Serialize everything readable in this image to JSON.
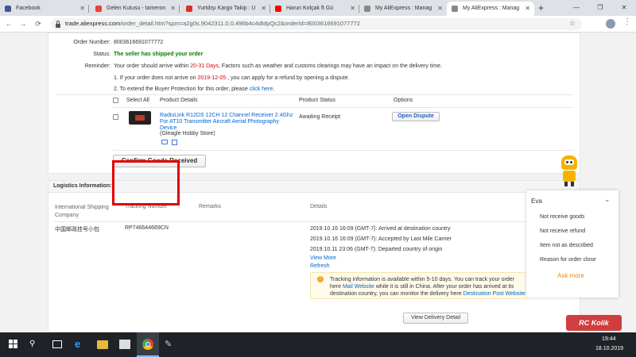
{
  "browser": {
    "tabs": [
      {
        "label": "Facebook",
        "color": "#3b5998"
      },
      {
        "label": "Gelen Kutusu - tameron",
        "color": "#ea4335"
      },
      {
        "label": "Yurtdışı Kargo Takip : U",
        "color": "#d93025"
      },
      {
        "label": "Harun Kolçak ft Gü",
        "color": "#ff0000"
      },
      {
        "label": "My AliExpress : Manag",
        "color": "#888888"
      },
      {
        "label": "My AliExpress : Manag",
        "color": "#888888"
      }
    ],
    "url_host": "trade.aliexpress.com",
    "url_path": "/order_detail.htm?spm=a2g0s.9042311.0.0.496b4c4dMpQc2&orderId=8003616691077772"
  },
  "order": {
    "number_label": "Order Number:",
    "number": "8003616691077772",
    "status_label": "Status:",
    "status": "The seller has shipped your order",
    "reminder_label": "Reminder:",
    "reminder_pre": "Your order should arrive within",
    "reminder_days": "20-31 Days",
    "reminder_post": ", Factors such as weather and customs clearings may have an impact on the delivery time.",
    "note1_pre": "1. If your order does not arrive on",
    "note1_date": "2019-12-05",
    "note1_post": ", you can apply for a refund by opening a dispute.",
    "note2_pre": "2. To extend the Buyer Protection for this order, please",
    "note2_link": "click here",
    "note2_post": "."
  },
  "products": {
    "headers": [
      "Select All",
      "Product Details",
      "Product Status",
      "Options"
    ],
    "item_title": "RadioLink R12DS 12CH 12 Channel Receiver 2.4Ghz For AT10 Transmitter Aircraft Aerial Photography Device",
    "item_store": "(Gleagle Hobby Store)",
    "item_status": "Awaiting Receipt",
    "dispute_button": "Open Dispute",
    "confirm_button": "Confirm Goods Received"
  },
  "logistics": {
    "title": "Logistics Information:",
    "headers": [
      "International Shipping Company",
      "Tracking Number",
      "Remarks",
      "Details"
    ],
    "company": "中国邮政挂号小包",
    "tracking_number": "RP746644669CN",
    "events": [
      "2019.10.16 16:09 (GMT-7): Arrived at destination country",
      "2019.10.16 16:09 (GMT-7): Accepted by Last Mile Carrier",
      "2019.10.11 23:06 (GMT-7): Departed country of origin"
    ],
    "view_more": "View More",
    "refresh": "Refresh",
    "info_pre": "Tracking information is available within 5-10 days. You can track your order here",
    "info_link1": "Mail Website",
    "info_mid": " while it is still in China. After your order has arrived at its destination country, you can monitor the delivery here",
    "info_link2": "Destination Post Website",
    "view_detail_button": "View Delivery Detail"
  },
  "chat": {
    "name": "Eva",
    "options": [
      "Not receive goods",
      "Not receive refund",
      "Item not as described",
      "Reason for order close"
    ],
    "ask_more": "Ask more"
  },
  "taskbar": {
    "time": "19:44",
    "date": "18.10.2019"
  },
  "watermark": "RC Kolik"
}
